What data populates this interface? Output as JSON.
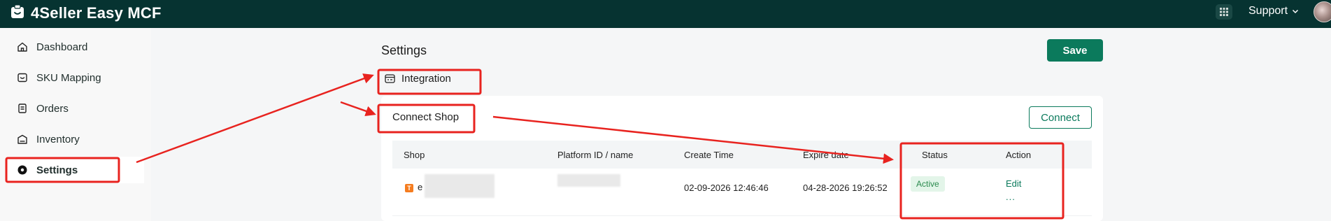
{
  "app": {
    "title": "4Seller Easy MCF"
  },
  "header": {
    "support_label": "Support"
  },
  "sidebar": {
    "items": [
      {
        "label": "Dashboard",
        "icon": "home-icon"
      },
      {
        "label": "SKU Mapping",
        "icon": "mapping-icon"
      },
      {
        "label": "Orders",
        "icon": "orders-icon"
      },
      {
        "label": "Inventory",
        "icon": "inventory-icon"
      },
      {
        "label": "Settings",
        "icon": "settings-icon",
        "active": true
      }
    ]
  },
  "page": {
    "title": "Settings",
    "save_label": "Save",
    "integration_label": "Integration"
  },
  "connect_shop": {
    "title": "Connect Shop",
    "connect_label": "Connect",
    "columns": [
      "Shop",
      "Platform ID / name",
      "Create Time",
      "Expire date",
      "Status",
      "Action"
    ],
    "rows": [
      {
        "shop_badge": "T",
        "shop_prefix": "e",
        "create_time": "02-09-2026 12:46:46",
        "expire_date": "04-28-2026 19:26:52",
        "status": "Active",
        "action_edit": "Edit",
        "action_more": "..."
      }
    ]
  },
  "colors": {
    "header_bg": "#063331",
    "primary": "#0b7a5c",
    "annotation_red": "#e8231f",
    "status_active": "#2b8a4e"
  }
}
